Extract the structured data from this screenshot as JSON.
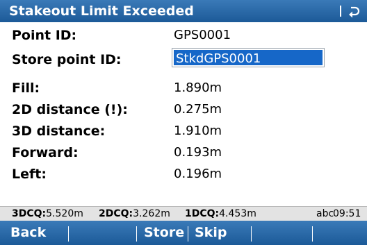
{
  "title": "Stakeout Limit Exceeded",
  "icons": {
    "back": "return-arrow-icon"
  },
  "colors": {
    "bar_blue": "#1c5a98",
    "selection_blue": "#1667c8",
    "status_gray": "#e3e3e3"
  },
  "fields": {
    "point_id": {
      "label": "Point ID:",
      "value": "GPS0001"
    },
    "store_point_id": {
      "label": "Store point ID:",
      "value": "StkdGPS0001"
    },
    "fill": {
      "label": "Fill:",
      "value": "1.890m"
    },
    "distance_2d": {
      "label": "2D distance (!):",
      "value": "0.275m"
    },
    "distance_3d": {
      "label": "3D distance:",
      "value": "1.910m"
    },
    "forward": {
      "label": "Forward:",
      "value": "0.193m"
    },
    "left": {
      "label": "Left:",
      "value": "0.196m"
    }
  },
  "status": {
    "dcq3_label": "3DCQ:",
    "dcq3_value": "5.520m",
    "dcq2_label": "2DCQ:",
    "dcq2_value": "3.262m",
    "dcq1_label": "1DCQ:",
    "dcq1_value": "4.453m",
    "input_mode": "abc",
    "time": "09:51"
  },
  "softkeys": {
    "f1": "Back",
    "f2": "",
    "f3": "Store",
    "f4": "Skip",
    "f5": "",
    "f6": ""
  }
}
